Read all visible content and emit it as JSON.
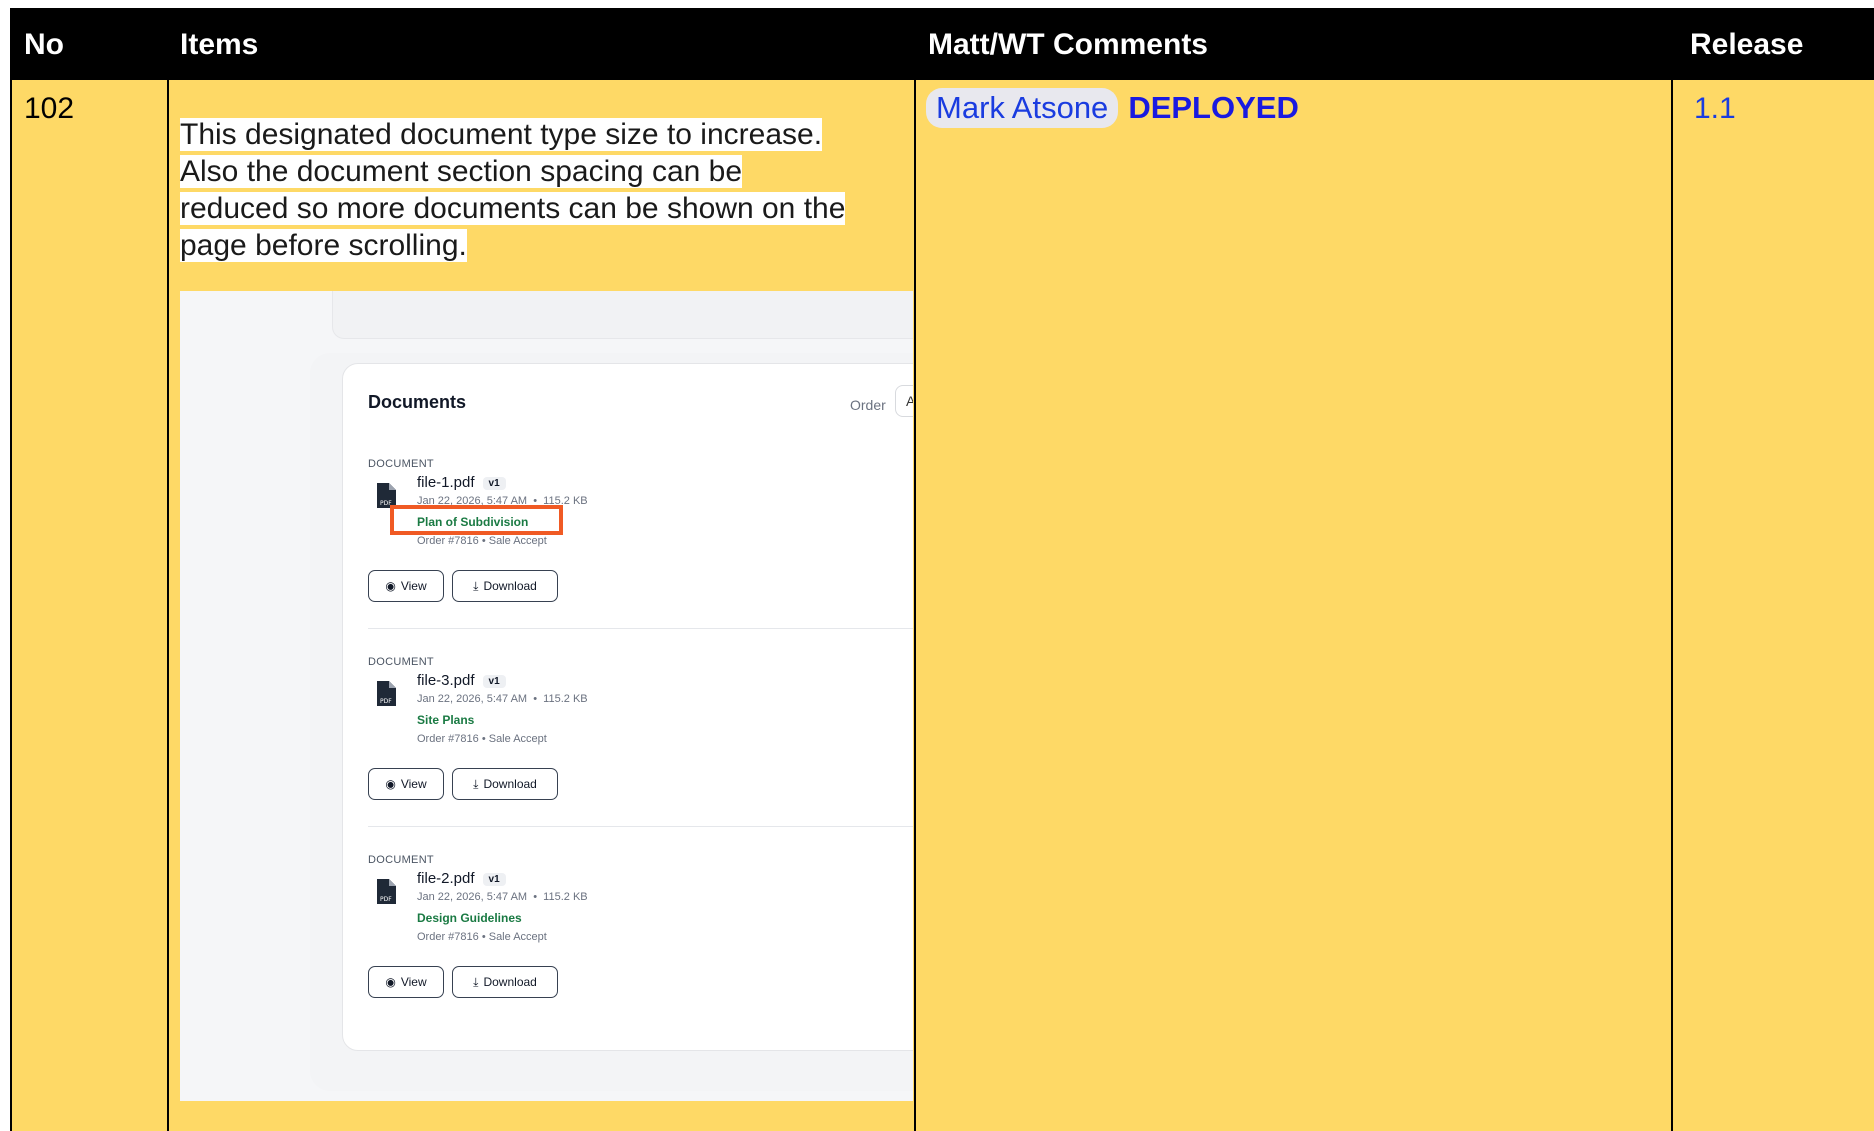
{
  "header": {
    "no": "No",
    "items": "Items",
    "comments": "Matt/WT Comments",
    "release": "Release"
  },
  "row": {
    "no": "102",
    "description_lines": [
      "This designated document type size to increase.",
      "Also the document section spacing can be",
      "reduced so more documents can be shown on the",
      "page before scrolling."
    ],
    "comment_user": "Mark Atsone",
    "comment_status": "DEPLOYED",
    "release": "1.1"
  },
  "screenshot": {
    "title": "Documents",
    "order_label": "Order",
    "order_value": "A",
    "documents": [
      {
        "label": "DOCUMENT",
        "filename": "file-1.pdf",
        "version": "v1",
        "date": "Jan 22, 2026, 5:47 AM",
        "size": "115.2 KB",
        "type": "Plan of Subdivision",
        "order": "Order #7816 • Sale Accept",
        "view": "View",
        "download": "Download"
      },
      {
        "label": "DOCUMENT",
        "filename": "file-3.pdf",
        "version": "v1",
        "date": "Jan 22, 2026, 5:47 AM",
        "size": "115.2 KB",
        "type": "Site Plans",
        "order": "Order #7816 • Sale Accept",
        "view": "View",
        "download": "Download"
      },
      {
        "label": "DOCUMENT",
        "filename": "file-2.pdf",
        "version": "v1",
        "date": "Jan 22, 2026, 5:47 AM",
        "size": "115.2 KB",
        "type": "Design Guidelines",
        "order": "Order #7816 • Sale Accept",
        "view": "View",
        "download": "Download"
      }
    ]
  },
  "colors": {
    "header_bg": "#000000",
    "row_bg": "#fed966",
    "link": "#1a3ce0",
    "highlight": "#f05a24",
    "doc_type": "#1a7a43"
  },
  "icons": [
    "pdf-file-icon",
    "eye-icon",
    "download-icon"
  ]
}
